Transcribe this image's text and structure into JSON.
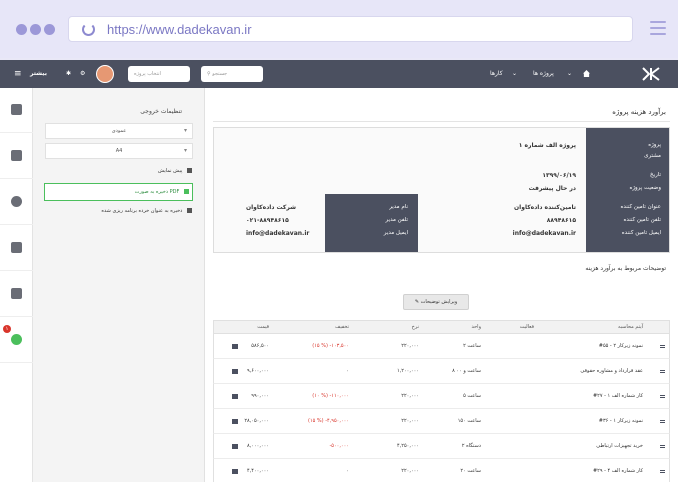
{
  "browser": {
    "url": "https://www.dadekavan.ir"
  },
  "topbar": {
    "nav_projects": "پروژه ها",
    "nav_tasks": "کارها",
    "search_placeholder": "جستجو",
    "project_select": "انتخاب پروژه",
    "user_name": "بیشتر"
  },
  "rail": {
    "items": [
      "flag-icon",
      "user-icon",
      "bulb-icon",
      "check-icon",
      "chat-icon",
      "alarm-icon"
    ],
    "badge": "۱"
  },
  "panel": {
    "title": "تنظیمات خروجی",
    "select1": "عمودی",
    "select2": "A4",
    "option_preview": "پیش نمایش",
    "option_pdf": "ذخیره به صورت PDF",
    "option_save_plan": "ذخیره به عنوان خرده برنامه ریزی شده"
  },
  "main": {
    "title": "برآورد هزینه پروژه",
    "labels": [
      "پروژه",
      "مشتری",
      "تاریخ",
      "وضعیت پروژه",
      "عنوان تامین کننده",
      "تلفن تامین کننده",
      "ایمیل تامین کننده"
    ],
    "project_name": "پروژه الف شماره ۱",
    "date": "۱۳۹۹/۰۶/۱۹",
    "status": "در حال پیشرفت",
    "supplier_name": "تامین‌کننده داده‌کاوان",
    "supplier_phone": "۸۸۹۴۸۶۱۵",
    "supplier_email": "info@dadekavan.ir",
    "mid_labels": [
      "نام مدیر",
      "تلفن مدیر",
      "ایمیل مدیر"
    ],
    "company_name": "شرکت داده‌کاوان",
    "company_phone": "۰۲۱-۸۸۹۴۸۶۱۵",
    "company_email": "info@dadekavan.ir",
    "description_label": "توضیحات مربوط به برآورد هزینه",
    "edit_button": "ویرایش توضیحات"
  },
  "table": {
    "headers": [
      "آیتم محاسبه",
      "فعالیت",
      "واحد",
      "نرخ",
      "تخفیف",
      "قیمت"
    ],
    "rows": [
      {
        "item": "#۵۵ - نمونه زیرکار ۲",
        "unit": "۲ ساعت",
        "rate": "۲۲۰,۰۰۰",
        "discount": "(۱۵ %) -۱۰۳,۵۰۰",
        "price": "۵۸۶,۵۰۰"
      },
      {
        "item": "عقد قرارداد و مشاوره حقوقی",
        "unit": "۸ ساعت و ۰۰",
        "rate": "۱,۲۰۰,۰۰۰",
        "discount": "۰",
        "price": "۹,۶۰۰,۰۰۰"
      },
      {
        "item": "#۲۷ - کار شماره الف ۱",
        "unit": "۵ ساعت",
        "rate": "۲۲۰,۰۰۰",
        "discount": "(۱۰ %) -۱۱۰,۰۰۰",
        "price": "۹۹۰,۰۰۰"
      },
      {
        "item": "#۳۶ - نمونه زیرکار ۱",
        "unit": "۱۵۰ ساعت",
        "rate": "۲۲۰,۰۰۰",
        "discount": "(۱۵ %) -۴,۹۵۰,۰۰۰",
        "price": "۲۸,۰۵۰,۰۰۰"
      },
      {
        "item": "خرید تجهیزات ارتباطی",
        "unit": "۲ دستگاه",
        "rate": "۴,۲۵۰,۰۰۰",
        "discount": "-۵۰۰,۰۰۰",
        "price": "۸,۰۰۰,۰۰۰"
      },
      {
        "item": "#۲۹ - کار شماره الف ۴",
        "unit": "۲۰ ساعت",
        "rate": "۲۲۰,۰۰۰",
        "discount": "۰",
        "price": "۴,۴۰۰,۰۰۰"
      }
    ]
  }
}
